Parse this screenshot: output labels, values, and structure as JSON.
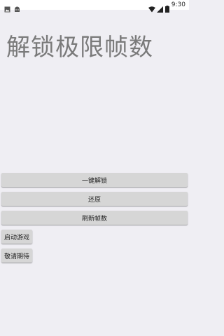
{
  "status_bar": {
    "left_icons": [
      "image-icon",
      "android-icon"
    ],
    "right_icons": [
      "wifi-icon",
      "signal-icon",
      "battery-icon"
    ],
    "time": "9:30"
  },
  "main": {
    "title": "解锁极限帧数",
    "buttons": {
      "unlock": "一键解锁",
      "restore": "还原",
      "refresh": "刷新帧数",
      "launch_game": "启动游戏",
      "coming_soon": "敬请期待"
    }
  },
  "colors": {
    "background": "#efeef3",
    "button": "#d6d6d6",
    "title_text": "#7a7a7a"
  }
}
